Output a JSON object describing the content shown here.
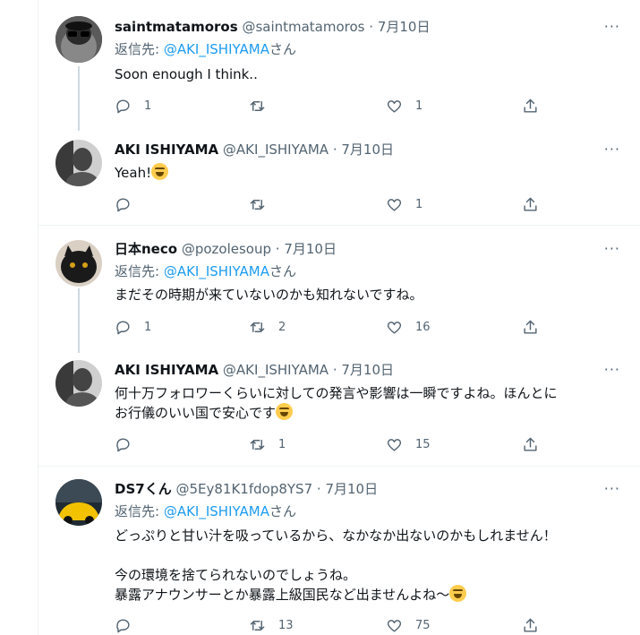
{
  "replying_prefix": "返信先: ",
  "replying_suffix": "さん",
  "more_glyph": "···",
  "tweets": [
    {
      "name": "saintmatamoros",
      "handle": "@saintmatamoros",
      "time": "· 7月10日",
      "replying_to": "@AKI_ISHIYAMA",
      "text": "Soon enough I think..",
      "replies": "1",
      "retweets": "",
      "likes": "1",
      "avatar_icon": "user-avatar"
    },
    {
      "name": "AKI ISHIYAMA",
      "handle": "@AKI_ISHIYAMA",
      "time": "· 7月10日",
      "text": "Yeah!",
      "replies": "",
      "retweets": "",
      "likes": "1",
      "avatar_icon": "user-avatar"
    },
    {
      "name": "日本neco",
      "handle": "@pozolesoup",
      "time": "· 7月10日",
      "replying_to": "@AKI_ISHIYAMA",
      "text": "まだその時期が来ていないのかも知れないですね。",
      "replies": "1",
      "retweets": "2",
      "likes": "16",
      "avatar_icon": "cat-avatar"
    },
    {
      "name": "AKI ISHIYAMA",
      "handle": "@AKI_ISHIYAMA",
      "time": "· 7月10日",
      "text_line1": "何十万フォロワーくらいに対しての発言や影響は一瞬ですよね。ほんとに",
      "text_line2": "お行儀のいい国で安心です",
      "replies": "",
      "retweets": "1",
      "likes": "15",
      "avatar_icon": "user-avatar"
    },
    {
      "name": "DS7くん",
      "handle": "@5Ey81K1fdop8YS7",
      "time": "· 7月10日",
      "replying_to": "@AKI_ISHIYAMA",
      "text_line1": "どっぷりと甘い汁を吸っているから、なかなか出ないのかもしれません！",
      "text_line2": "今の環境を捨てられないのでしょうね。",
      "text_line3": "暴露アナウンサーとか暴露上級国民など出ませんよね～",
      "replies": "",
      "retweets": "13",
      "likes": "75",
      "avatar_icon": "car-avatar"
    }
  ]
}
